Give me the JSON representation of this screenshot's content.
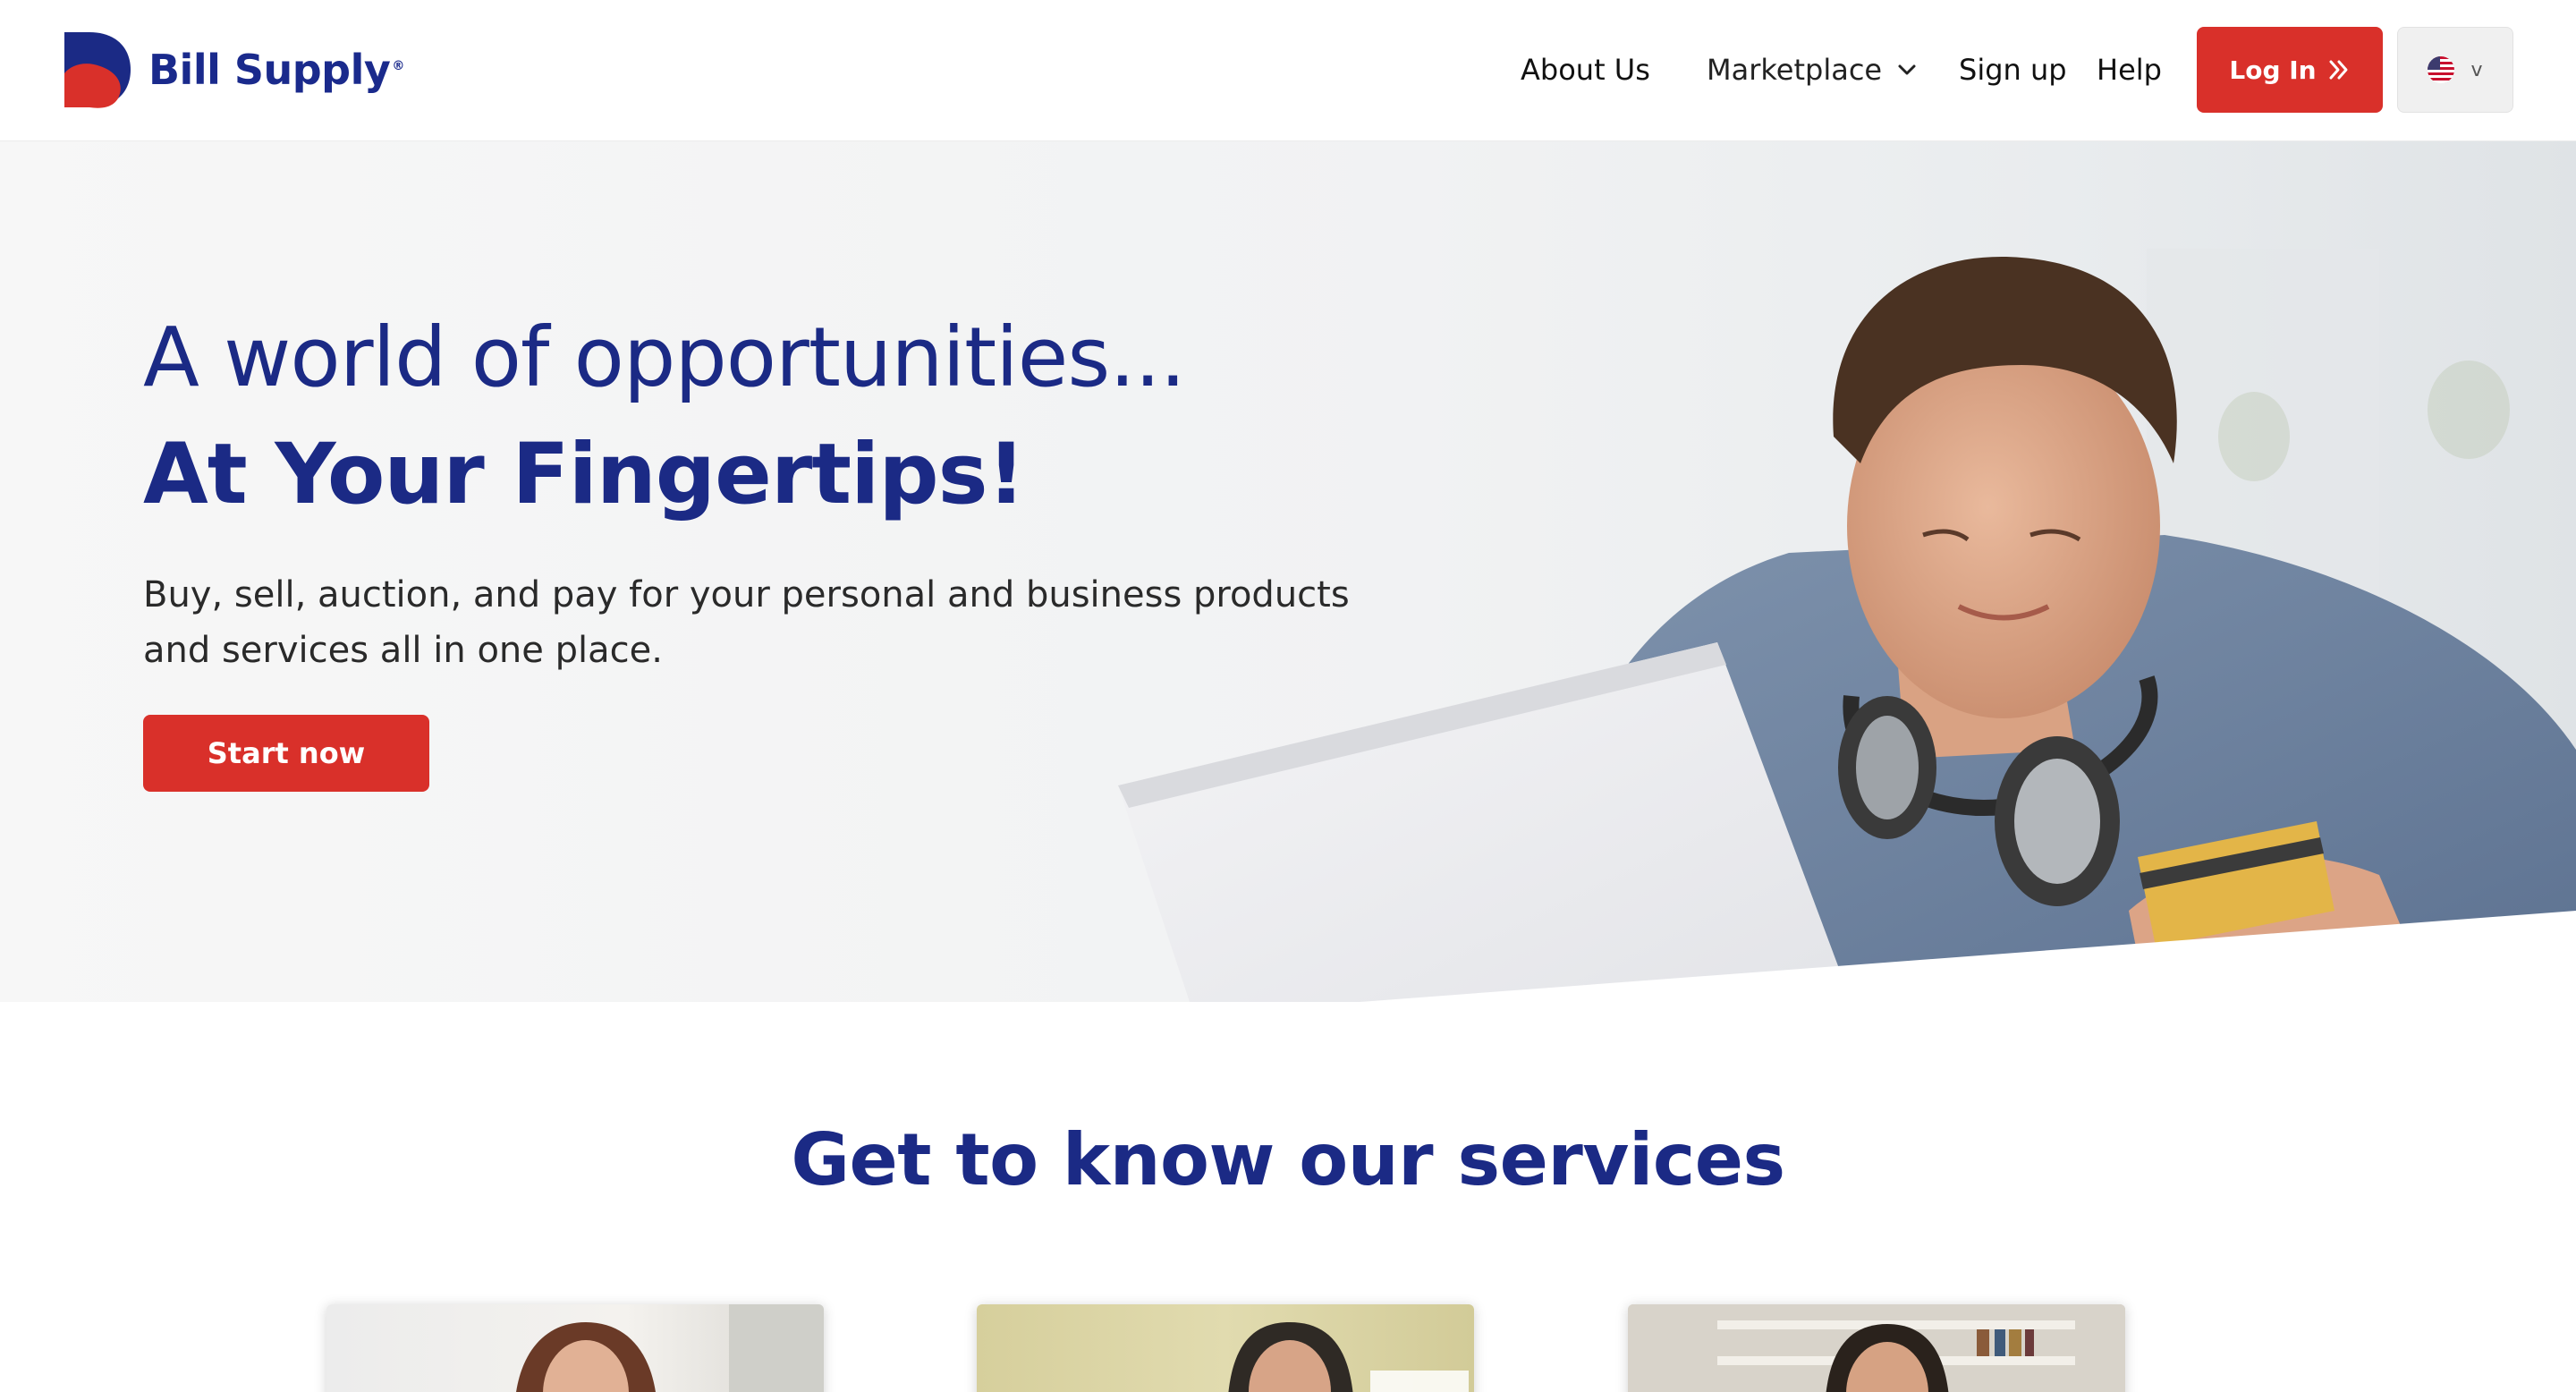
{
  "brand": {
    "name": "Bill Supply",
    "registered_mark": "®",
    "primary_color": "#1b2a85",
    "accent_color": "#d9302a"
  },
  "nav": {
    "about": "About Us",
    "marketplace": "Marketplace",
    "signup": "Sign up",
    "help": "Help",
    "login": "Log In",
    "language_caret": "v"
  },
  "hero": {
    "title": "A world of opportunities...",
    "subtitle": "At Your Fingertips!",
    "description": "Buy, sell, auction, and pay for your personal and business products and services all in one place.",
    "cta": "Start now"
  },
  "services": {
    "title": "Get to know our services"
  },
  "icons": [
    "logo-mark",
    "chevron-down-icon",
    "double-chevron-right-icon",
    "us-flag-icon"
  ]
}
